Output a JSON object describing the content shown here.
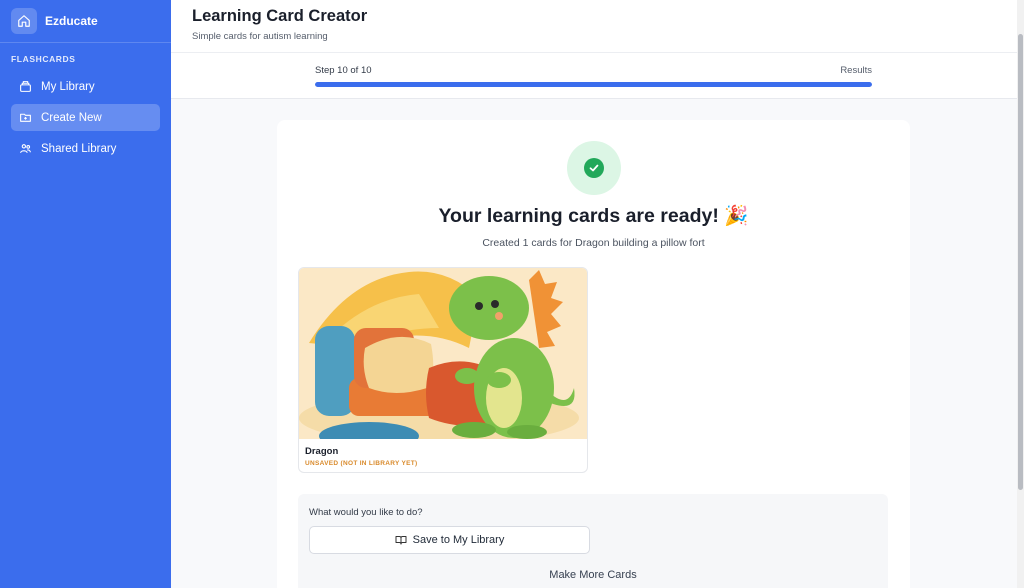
{
  "app": {
    "name": "Ezducate"
  },
  "sidebar": {
    "section_label": "FLASHCARDS",
    "items": [
      {
        "label": "My Library",
        "icon": "library-icon",
        "active": false
      },
      {
        "label": "Create New",
        "icon": "folder-plus-icon",
        "active": true
      },
      {
        "label": "Shared Library",
        "icon": "users-icon",
        "active": false
      }
    ]
  },
  "header": {
    "title": "Learning Card Creator",
    "subtitle": "Simple cards for autism learning"
  },
  "progress": {
    "step_label": "Step 10 of 10",
    "end_label": "Results",
    "fraction": 1.0
  },
  "result": {
    "title": "Your learning cards are ready! 🎉",
    "subtitle": "Created 1 cards for Dragon building a pillow fort"
  },
  "cards": [
    {
      "title": "Dragon",
      "status": "UNSAVED (NOT IN LIBRARY YET)",
      "image": "dragon-pillow-fort-illustration"
    }
  ],
  "actions": {
    "question": "What would you like to do?",
    "save_label": "Save to My Library",
    "more_label": "Make More Cards"
  },
  "colors": {
    "sidebar_bg": "#3b6ded",
    "progress_fill": "#3b6ded",
    "success_green": "#22a85a",
    "unsaved_orange": "#d98a2b"
  }
}
